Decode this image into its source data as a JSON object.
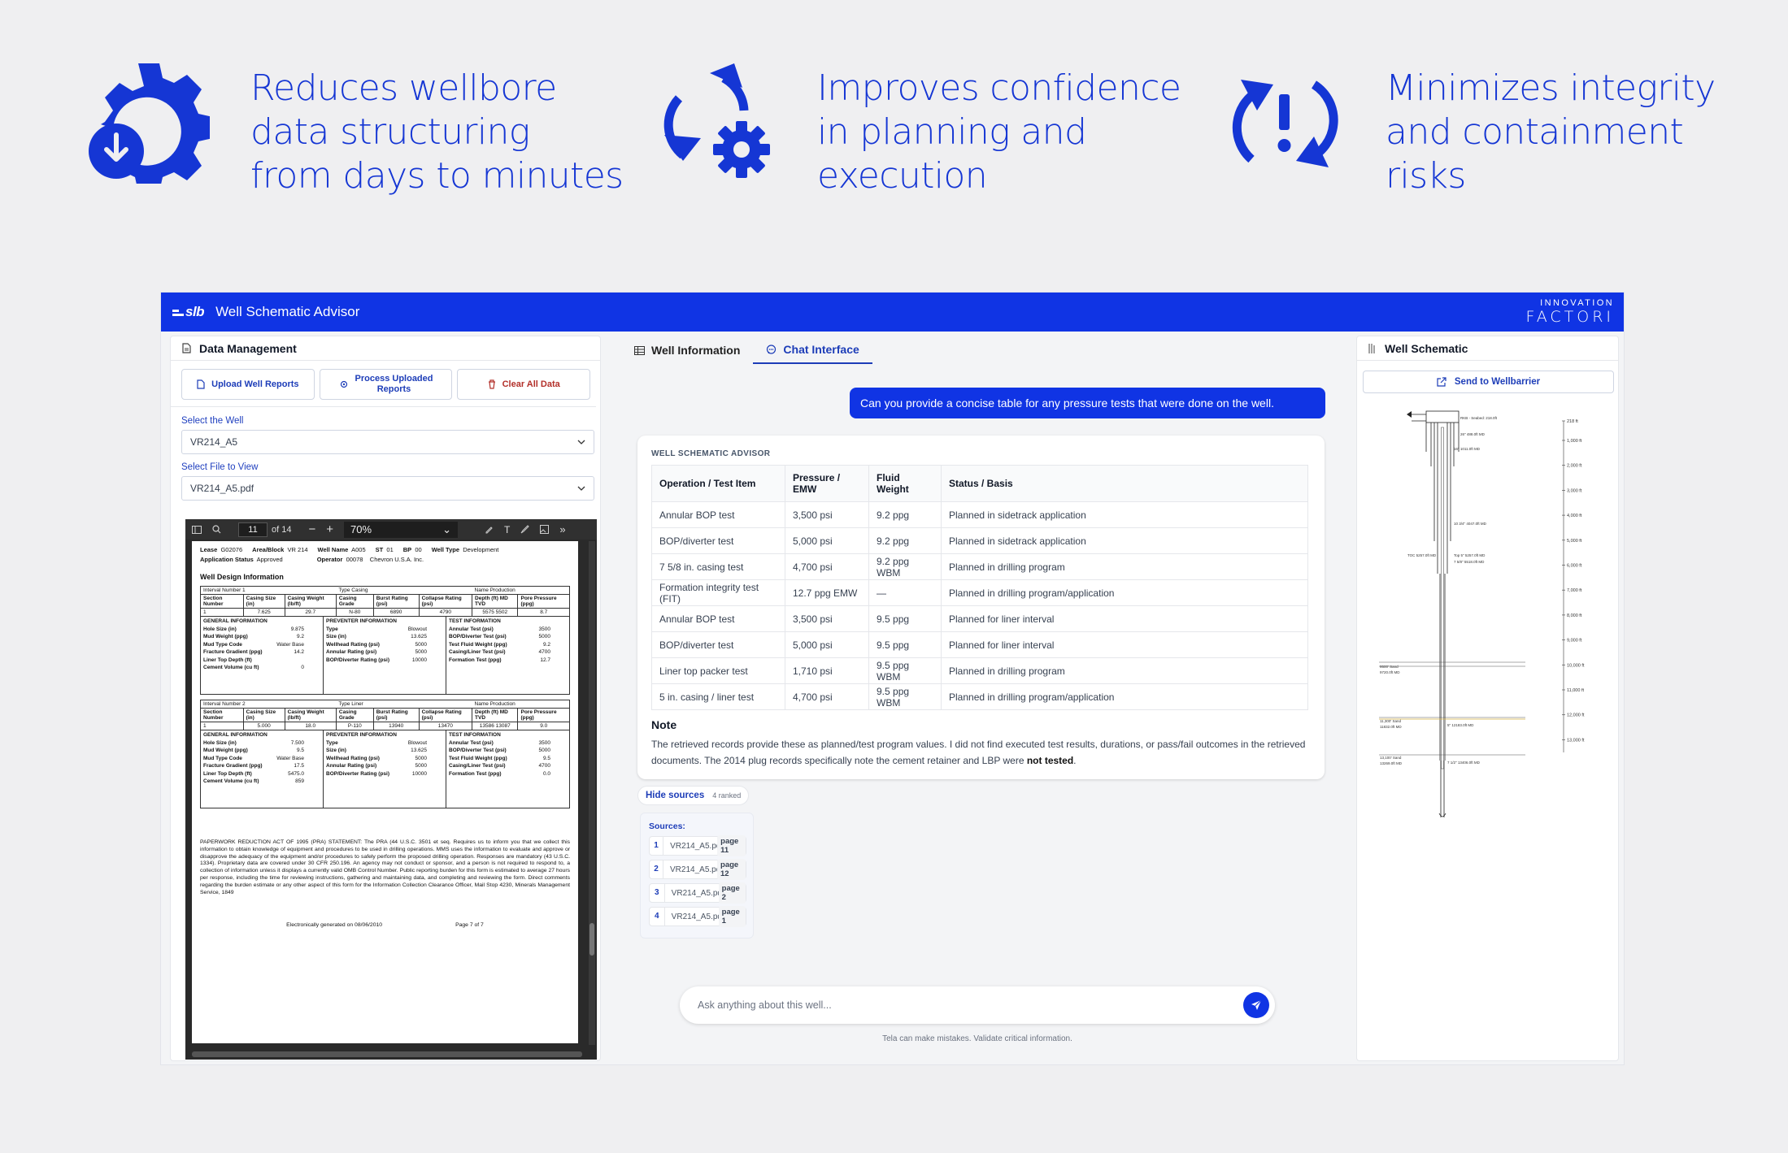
{
  "features": [
    {
      "icon": "gear-download-icon",
      "text": "Reduces wellbore\ndata structuring\nfrom days to minutes"
    },
    {
      "icon": "refresh-gear-icon",
      "text": "Improves confidence\nin planning and\nexecution"
    },
    {
      "icon": "refresh-alert-icon",
      "text": "Minimizes integrity\nand containment\nrisks"
    }
  ],
  "app": {
    "logo": "slb",
    "title": "Well Schematic Advisor",
    "brand_top": "INNOVATION",
    "brand_bottom": "FACTORI",
    "accent": "#1034e4"
  },
  "data_management": {
    "title": "Data Management",
    "upload_label": "Upload Well Reports",
    "process_label": "Process Uploaded\nReports",
    "clear_label": "Clear All Data",
    "well_label": "Select the Well",
    "well_value": "VR214_A5",
    "file_label": "Select File to View",
    "file_value": "VR214_A5.pdf"
  },
  "pdf": {
    "page": "11",
    "of": "of 14",
    "zoom": "70%",
    "header": {
      "lease_k": "Lease",
      "lease_v": "G02076",
      "area_k": "Area/Block",
      "area_v": "VR 214",
      "well_k": "Well Name",
      "well_v": "A005",
      "st_k": "ST",
      "st_v": "01",
      "bp_k": "BP",
      "bp_v": "00",
      "type_k": "Well Type",
      "type_v": "Development",
      "status_k": "Application Status",
      "status_v": "Approved",
      "op_k": "Operator",
      "op_v": "00078",
      "op_name": "Chevron U.S.A. Inc."
    },
    "section_title": "Well Design Information",
    "intervals": [
      {
        "interval": "Interval Number  1",
        "type": "Type   Casing",
        "name": "Name  Production",
        "cols": [
          "Section Number",
          "Casing Size (in)",
          "Casing Weight (lb/ft)",
          "Casing Grade",
          "Burst Rating (psi)",
          "Collapse Rating (psi)",
          "Depth (ft) MD  TVD",
          "Pore Pressure (ppg)"
        ],
        "row": [
          "1",
          "7.625",
          "29.7",
          "N-80",
          "6890",
          "4790",
          "5575   5502",
          "8.7"
        ],
        "general": [
          [
            "Hole Size (in)",
            "9.875"
          ],
          [
            "Mud Weight (ppg)",
            "9.2"
          ],
          [
            "Mud Type Code",
            "Water Base"
          ],
          [
            "Fracture Gradient (ppg)",
            "14.2"
          ],
          [
            "Liner Top Depth (ft)",
            ""
          ],
          [
            "Cement Volume (cu ft)",
            "0"
          ]
        ],
        "preventer": [
          [
            "Type",
            "Blowout"
          ],
          [
            "Size (in)",
            "13.625"
          ],
          [
            "Wellhead Rating (psi)",
            "5000"
          ],
          [
            "Annular Rating (psi)",
            "5000"
          ],
          [
            "BOP/Diverter Rating (psi)",
            "10000"
          ]
        ],
        "test": [
          [
            "Annular Test (psi)",
            "3500"
          ],
          [
            "BOP/Diverter Test (psi)",
            "5000"
          ],
          [
            "Test Fluid Weight (ppg)",
            "9.2"
          ],
          [
            "Casing/Liner Test (psi)",
            "4700"
          ],
          [
            "Formation Test (ppg)",
            "12.7"
          ]
        ]
      },
      {
        "interval": "Interval Number  2",
        "type": "Type   Liner",
        "name": "Name  Production",
        "cols": [
          "Section Number",
          "Casing Size (in)",
          "Casing Weight (lb/ft)",
          "Casing Grade",
          "Burst Rating (psi)",
          "Collapse Rating (psi)",
          "Depth (ft) MD  TVD",
          "Pore Pressure (ppg)"
        ],
        "row": [
          "1",
          "5.000",
          "18.0",
          "P-110",
          "13940",
          "13470",
          "13586   13087",
          "9.0"
        ],
        "general": [
          [
            "Hole Size (in)",
            "7.500"
          ],
          [
            "Mud Weight (ppg)",
            "9.5"
          ],
          [
            "Mud Type Code",
            "Water Base"
          ],
          [
            "Fracture Gradient (ppg)",
            "17.5"
          ],
          [
            "Liner Top Depth (ft)",
            "5475.0"
          ],
          [
            "Cement Volume (cu ft)",
            "859"
          ]
        ],
        "preventer": [
          [
            "Type",
            "Blowout"
          ],
          [
            "Size (in)",
            "13.625"
          ],
          [
            "Wellhead Rating (psi)",
            "5000"
          ],
          [
            "Annular Rating (psi)",
            "5000"
          ],
          [
            "BOP/Diverter Rating (psi)",
            "10000"
          ]
        ],
        "test": [
          [
            "Annular Test (psi)",
            "3500"
          ],
          [
            "BOP/Diverter Test (psi)",
            "5000"
          ],
          [
            "Test Fluid Weight (ppg)",
            "9.5"
          ],
          [
            "Casing/Liner Test (psi)",
            "4700"
          ],
          [
            "Formation Test (ppg)",
            "0.0"
          ]
        ]
      }
    ],
    "gi_head": "GENERAL INFORMATION",
    "pi_head": "PREVENTER INFORMATION",
    "ti_head": "TEST INFORMATION",
    "paperwork": "PAPERWORK REDUCTION ACT OF 1995 (PRA) STATEMENT: The PRA (44 U.S.C. 3501 et seq. Requires us to inform you that we collect this information to obtain knowledge of equipment and procedures to be used in drilling operations. MMS uses the information to evaluate and approve or disapprove the adequacy of the equipment and/or procedures to safely perform the proposed drilling operation. Responses are mandatory (43 U.S.C. 1334). Proprietary data are covered under 30 CFR 250.196. An agency may not conduct or sponsor, and a person is not required to respond to, a collection of information unless it displays a currently valid OMB Control Number. Public reporting burden for this form is estimated to average 27 hours per response, including the time for reviewing instructions, gathering and maintaining data, and completing and reviewing the form.  Direct comments regarding the burden estimate or any other aspect of this form for the Information Collection Clearance Officer, Mail Stop 4230, Minerals Management Service, 1849",
    "generated": "Electronically generated on     08/06/2010",
    "page_of": "Page   7       of   7"
  },
  "tabs": [
    {
      "label": "Well Information",
      "icon": "table-icon"
    },
    {
      "label": "Chat Interface",
      "icon": "chat-icon"
    }
  ],
  "chat": {
    "question": "Can you provide a concise table for any pressure tests that were done on the well.",
    "eyebrow": "WELL SCHEMATIC ADVISOR",
    "headers": [
      "Operation / Test Item",
      "Pressure / EMW",
      "Fluid Weight",
      "Status / Basis"
    ],
    "rows": [
      [
        "Annular BOP test",
        "3,500 psi",
        "9.2 ppg",
        "Planned in sidetrack application"
      ],
      [
        "BOP/diverter test",
        "5,000 psi",
        "9.2 ppg",
        "Planned in sidetrack application"
      ],
      [
        "7 5/8 in. casing test",
        "4,700 psi",
        "9.2 ppg WBM",
        "Planned in drilling program"
      ],
      [
        "Formation integrity test (FIT)",
        "12.7 ppg EMW",
        "—",
        "Planned in drilling program/application"
      ],
      [
        "Annular BOP test",
        "3,500 psi",
        "9.5 ppg",
        "Planned for liner interval"
      ],
      [
        "BOP/diverter test",
        "5,000 psi",
        "9.5 ppg",
        "Planned for liner interval"
      ],
      [
        "Liner top packer test",
        "1,710 psi",
        "9.5 ppg WBM",
        "Planned in drilling program"
      ],
      [
        "5 in. casing / liner test",
        "4,700 psi",
        "9.5 ppg WBM",
        "Planned in drilling program/application"
      ]
    ],
    "note_title": "Note",
    "note_a": "The retrieved records provide these as planned/test program values. I did not find executed test results, durations, or pass/fail outcomes in the retrieved documents. The 2014 plug records specifically note the cement retainer and LBP were ",
    "note_b": "not tested",
    "note_c": ".",
    "hide_label": "Hide sources",
    "ranked": "4 ranked",
    "sources_title": "Sources:",
    "sources": [
      {
        "n": "1",
        "file": "VR214_A5.pdf",
        "page": "page 11"
      },
      {
        "n": "2",
        "file": "VR214_A5.pdf",
        "page": "page 12"
      },
      {
        "n": "3",
        "file": "VR214_A5.pdf",
        "page": "page 2"
      },
      {
        "n": "4",
        "file": "VR214_A5.pdf",
        "page": "page 1"
      }
    ],
    "placeholder": "Ask anything about this well...",
    "disclaimer": "Tela can make mistakes. Validate critical information."
  },
  "schematic": {
    "title": "Well Schematic",
    "send_label": "Send to Wellbarrier",
    "depth_ticks": [
      "218 ft",
      "1,000 ft",
      "2,000 ft",
      "3,000 ft",
      "4,000 ft",
      "5,000 ft",
      "6,000 ft",
      "7,000 ft",
      "8,000 ft",
      "9,000 ft",
      "10,000 ft",
      "11,000 ft",
      "12,000 ft",
      "13,000 ft"
    ],
    "labels": {
      "rkb": "RKB - Seabed: 218.0ft",
      "c26": "26\" 488.0ft MD",
      "c16": "16\" 1011.0ft MD",
      "c1034": "10 3/4\" 4047.0ft MD",
      "toc": "TOC 5257.0ft MD",
      "top5": "Top 5\" 5257.0ft MD",
      "c758": "7 5/8\" 5518.0ft MD",
      "s9500": "9500' Sand",
      "s9500md": "9720.0ft MD",
      "s11300": "11,300' Sand",
      "s11300md": "11832.0ft MD",
      "c5": "5\" 12183.0ft MD",
      "s13100": "13,100' Sand",
      "s13100md": "13269.0ft MD",
      "c712": "7 1/2\" 13406.0ft MD"
    }
  }
}
